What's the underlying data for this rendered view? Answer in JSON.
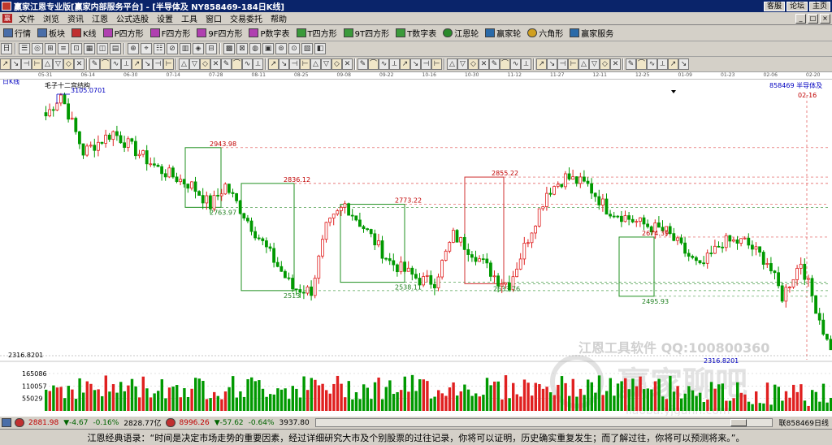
{
  "window": {
    "title": "赢家江恩专业版[赢家内部服务平台] - [半导体及  NY858469-184日K线]",
    "links": [
      "客服",
      "论坛",
      "主页"
    ]
  },
  "menu": {
    "items": [
      "文件",
      "浏览",
      "资讯",
      "江恩",
      "公式选股",
      "设置",
      "工具",
      "窗口",
      "交易委托",
      "帮助"
    ]
  },
  "toolbar1": {
    "items": [
      "行情",
      "板块",
      "K线",
      "P四方形",
      "F四方形",
      "9F四方形",
      "P数字表",
      "T四方形",
      "9T四方形",
      "T数字表",
      "江恩轮",
      "赢家轮",
      "六角形",
      "赢家服务"
    ]
  },
  "chart_data": {
    "type": "candlestick",
    "title": "毛子十二宫结构",
    "period_label": "日K线",
    "code_label": "858469",
    "name_label": "半导体及",
    "date_marker": "02-16",
    "x_dates": [
      "05-31",
      "06-14",
      "06-30",
      "07-14",
      "07-28",
      "08-11",
      "08-25",
      "09-08",
      "09-22",
      "10-16",
      "10-30",
      "11-12",
      "11-27",
      "12-11",
      "12-25",
      "01-09",
      "01-23",
      "02-06",
      "02-20"
    ],
    "price_axis_label": "2316.8201",
    "price_range": [
      2316.8201,
      3105.0701
    ],
    "annotations": [
      {
        "text": "3105.0701",
        "price": 3105.0701
      },
      {
        "text": "2943.98",
        "price": 2943.98
      },
      {
        "text": "2763.97",
        "price": 2763.97
      },
      {
        "text": "2836.12",
        "price": 2836.12
      },
      {
        "text": "2513",
        "price": 2513
      },
      {
        "text": "2773.22",
        "price": 2773.22
      },
      {
        "text": "2538.11",
        "price": 2538.11
      },
      {
        "text": "2855.22",
        "price": 2855.22
      },
      {
        "text": "2533.76",
        "price": 2533.76
      },
      {
        "text": "2674.39",
        "price": 2674.39
      },
      {
        "text": "2495.93",
        "price": 2495.93
      },
      {
        "text": "2316.8201",
        "price": 2316.8201
      }
    ],
    "boxes": [
      {
        "color": "green",
        "high": 2943.98,
        "low": 2763.97
      },
      {
        "color": "green",
        "high": 2836.12,
        "low": 2513
      },
      {
        "color": "green",
        "high": 2773.22,
        "low": 2538.11
      },
      {
        "color": "red",
        "high": 2855.22,
        "low": 2533.76
      },
      {
        "color": "green",
        "high": 2674.39,
        "low": 2495.93
      }
    ],
    "volume_axis_labels": [
      "165086",
      "110057",
      "55029"
    ],
    "volume_ticks": [
      165086,
      110057,
      55029
    ]
  },
  "watermark": {
    "line1": "江恩工具软件  QQ:100800360",
    "line2": "赢家聊吧",
    "line3": "liaoba.yjgann.com"
  },
  "status": {
    "idx1_value": "2881.98",
    "idx1_change": "▼-4.67",
    "idx1_pct": "-0.16%",
    "idx1_amount": "2828.77亿",
    "idx2_value": "8996.26",
    "idx2_change": "▼-57.62",
    "idx2_pct": "-0.64%",
    "idx2_amount": "3937.80",
    "right_label": "联858469日线"
  },
  "quote": {
    "text": "江恩经典语录：“时间是决定市场走势的重要因素，经过详细研究大市及个别股票的过往记录，你将可以证明，历史确实重复发生；而了解过往，你将可以预测将来。”。"
  },
  "colors": {
    "up": "#e02020",
    "down": "#009900",
    "box_red": "#d03030",
    "box_green": "#209020",
    "title_bg": "#0a246a"
  }
}
